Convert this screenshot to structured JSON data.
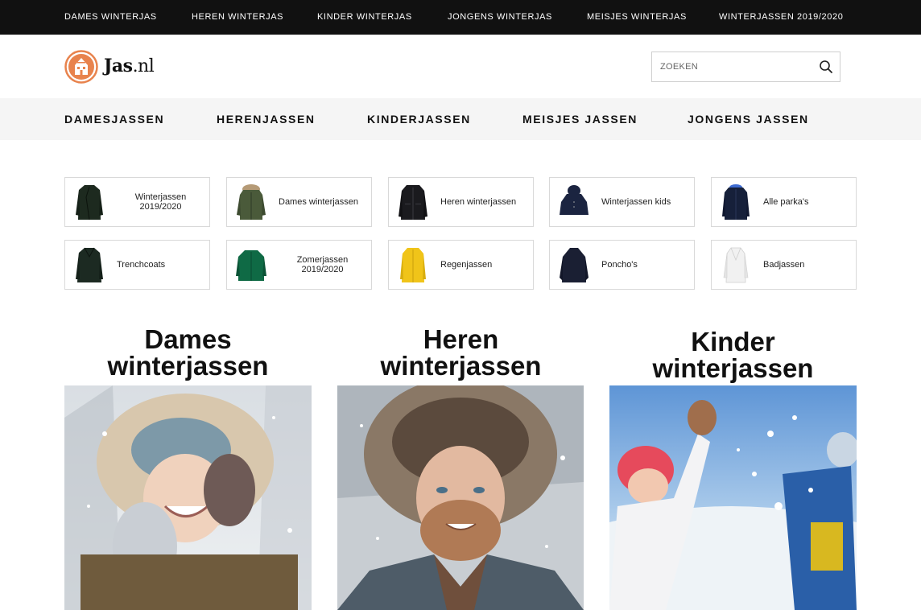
{
  "topbar": {
    "items": [
      {
        "label": "DAMES WINTERJAS"
      },
      {
        "label": "HEREN WINTERJAS"
      },
      {
        "label": "KINDER WINTERJAS"
      },
      {
        "label": "JONGENS WINTERJAS"
      },
      {
        "label": "MEISJES WINTERJAS"
      },
      {
        "label": "WINTERJASSEN 2019/2020"
      }
    ]
  },
  "header": {
    "logo_text_bold": "Jas",
    "logo_text_light": ".nl",
    "search": {
      "placeholder": "ZOEKEN",
      "icon": "search-icon"
    }
  },
  "mainnav": {
    "items": [
      {
        "label": "DAMESJASSEN"
      },
      {
        "label": "HERENJASSEN"
      },
      {
        "label": "KINDERJASSEN"
      },
      {
        "label": "MEISJES JASSEN"
      },
      {
        "label": "JONGENS JASSEN"
      }
    ]
  },
  "categories": [
    {
      "label": "Winterjassen 2019/2020",
      "color": "#1d2a1f"
    },
    {
      "label": "Dames winterjassen",
      "color": "#4a5a3a"
    },
    {
      "label": "Heren winterjassen",
      "color": "#1a1a1e"
    },
    {
      "label": "Winterjassen kids",
      "color": "#1b2440"
    },
    {
      "label": "Alle parka's",
      "color": "#16203a"
    },
    {
      "label": "Trenchcoats",
      "color": "#1c2a22"
    },
    {
      "label": "Zomerjassen 2019/2020",
      "color": "#0f6a45"
    },
    {
      "label": "Regenjassen",
      "color": "#f0c419"
    },
    {
      "label": "Poncho's",
      "color": "#1a1f33"
    },
    {
      "label": "Badjassen",
      "color": "#eeeeee"
    }
  ],
  "promos": [
    {
      "title_line1": "Dames",
      "title_line2": "winterjassen"
    },
    {
      "title_line1": "Heren",
      "title_line2": "winterjassen"
    },
    {
      "title_line1": "Kinder",
      "title_line2": "winterjassen"
    }
  ],
  "colors": {
    "topbar_bg": "#111111",
    "nav_bg": "#f5f5f5",
    "logo_orange": "#e8834d"
  }
}
